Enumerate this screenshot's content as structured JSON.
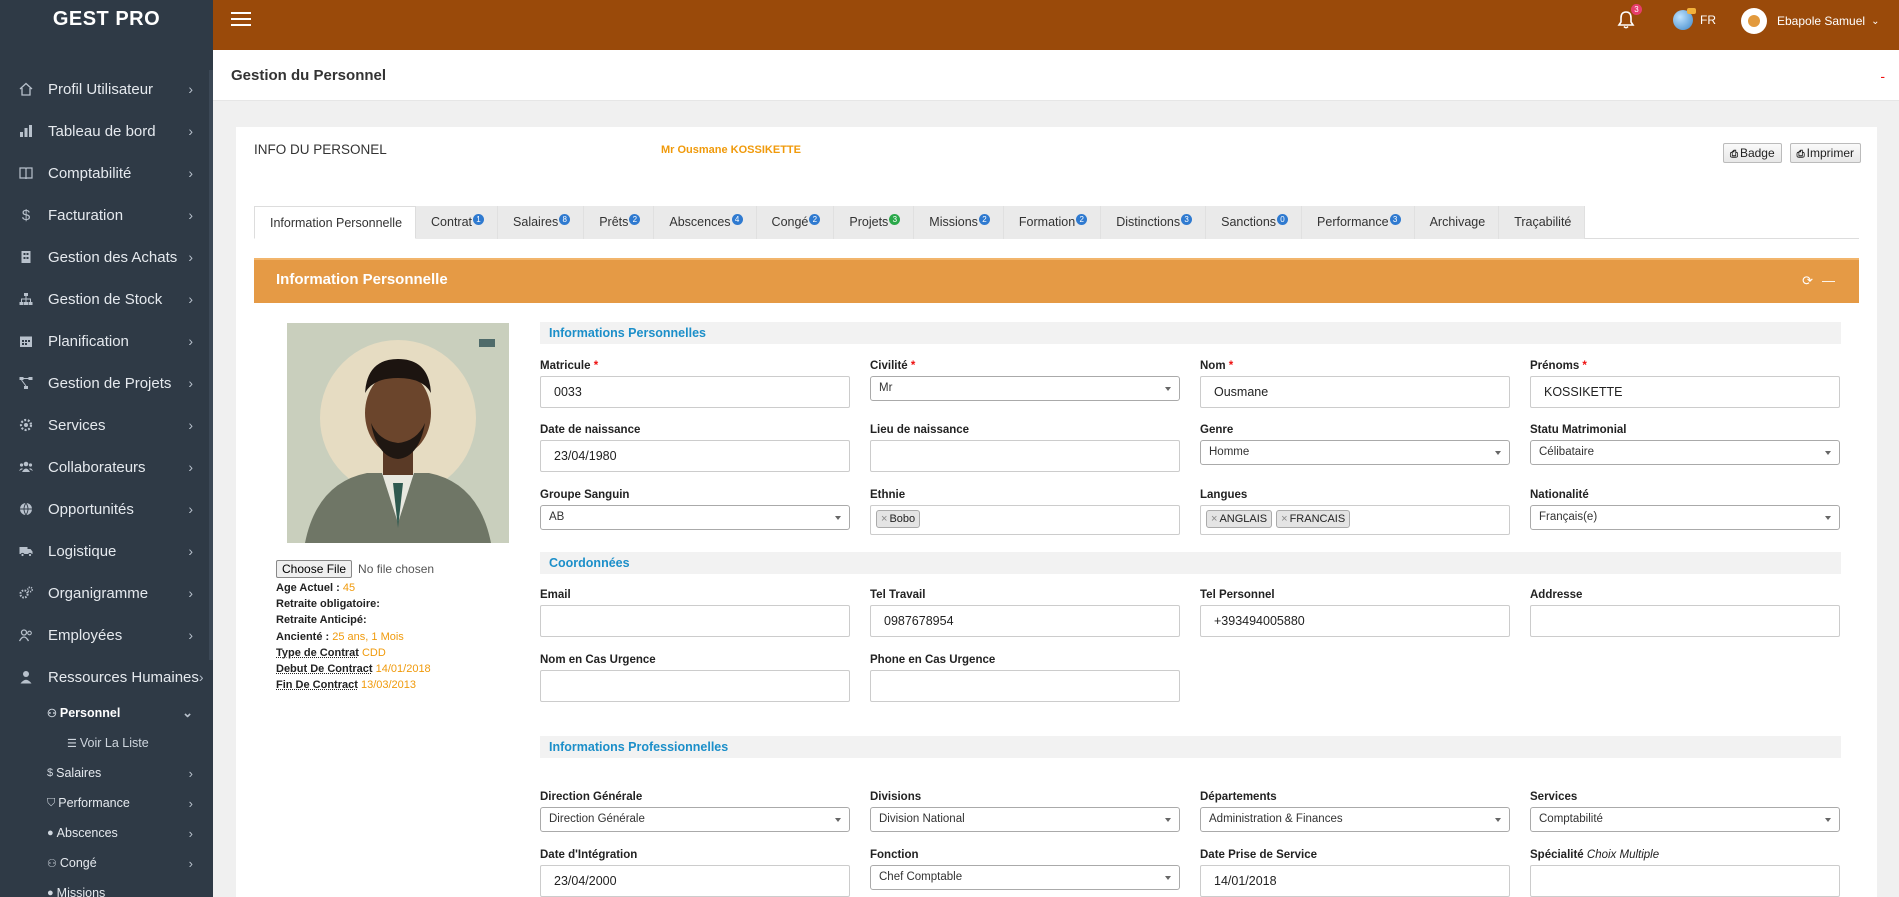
{
  "brand": "GEST PRO",
  "sidebar": {
    "items": [
      {
        "label": "Profil Utilisateur"
      },
      {
        "label": "Tableau de bord"
      },
      {
        "label": "Comptabilité"
      },
      {
        "label": "Facturation"
      },
      {
        "label": "Gestion des Achats"
      },
      {
        "label": "Gestion de Stock"
      },
      {
        "label": "Planification"
      },
      {
        "label": "Gestion de Projets"
      },
      {
        "label": "Services"
      },
      {
        "label": "Collaborateurs"
      },
      {
        "label": "Opportunités"
      },
      {
        "label": "Logistique"
      },
      {
        "label": "Organigramme"
      },
      {
        "label": "Employées"
      },
      {
        "label": "Ressources Humaines"
      }
    ],
    "sub": {
      "personnel": "Personnel",
      "voir_liste": "Voir La Liste",
      "salaires": "Salaires",
      "performance": "Performance",
      "abscences": "Abscences",
      "conge": "Congé",
      "missions": "Missions"
    }
  },
  "topbar": {
    "notif_count": "3",
    "lang": "FR",
    "user": "Ebapole Samuel"
  },
  "page": {
    "title": "Gestion du Personnel",
    "dash": "-"
  },
  "card": {
    "title": "INFO DU PERSONEL",
    "name": "Mr Ousmane KOSSIKETTE",
    "badge_btn": "Badge",
    "print_btn": "Imprimer"
  },
  "tabs": [
    {
      "label": "Information Personnelle",
      "count": ""
    },
    {
      "label": "Contrat",
      "count": "1"
    },
    {
      "label": "Salaires",
      "count": "8"
    },
    {
      "label": "Prêts",
      "count": "2"
    },
    {
      "label": "Abscences",
      "count": "4"
    },
    {
      "label": "Congé",
      "count": "2"
    },
    {
      "label": "Projets",
      "count": "3"
    },
    {
      "label": "Missions",
      "count": "2"
    },
    {
      "label": "Formation",
      "count": "2"
    },
    {
      "label": "Distinctions",
      "count": "3"
    },
    {
      "label": "Sanctions",
      "count": "0"
    },
    {
      "label": "Performance",
      "count": "3"
    },
    {
      "label": "Archivage",
      "count": ""
    },
    {
      "label": "Traçabilité",
      "count": ""
    }
  ],
  "panel": {
    "title": "Information Personnelle"
  },
  "left": {
    "file_btn": "Choose File",
    "file_txt": "No file chosen",
    "age_k": "Age Actuel :",
    "age_v": "45",
    "retraite_obl": "Retraite obligatoire:",
    "retraite_ant": "Retraite Anticipé:",
    "anciennete_k": "Ancienté :",
    "anciennete_v": "25 ans, 1 Mois",
    "contrat_k": "Type de Contrat",
    "contrat_v": "CDD",
    "debut_k": "Debut De Contract",
    "debut_v": "14/01/2018",
    "fin_k": "Fin De Contract",
    "fin_v": "13/03/2013"
  },
  "sections": {
    "perso": "Informations Personnelles",
    "coord": "Coordonnées",
    "pro": "Informations Professionnelles"
  },
  "form": {
    "matricule": {
      "label": "Matricule",
      "value": "0033"
    },
    "civilite": {
      "label": "Civilité",
      "value": "Mr"
    },
    "nom": {
      "label": "Nom",
      "value": "Ousmane"
    },
    "prenoms": {
      "label": "Prénoms",
      "value": "KOSSIKETTE"
    },
    "naissance": {
      "label": "Date de naissance",
      "value": "23/04/1980"
    },
    "lieu": {
      "label": "Lieu de naissance",
      "value": ""
    },
    "genre": {
      "label": "Genre",
      "value": "Homme"
    },
    "statu": {
      "label": "Statu Matrimonial",
      "value": "Célibataire"
    },
    "groupe": {
      "label": "Groupe Sanguin",
      "value": "AB"
    },
    "ethnie": {
      "label": "Ethnie",
      "tags": [
        "Bobo"
      ]
    },
    "langues": {
      "label": "Langues",
      "tags": [
        "ANGLAIS",
        "FRANCAIS"
      ]
    },
    "nationalite": {
      "label": "Nationalité",
      "value": "Français(e)"
    },
    "email": {
      "label": "Email",
      "value": ""
    },
    "tel_travail": {
      "label": "Tel Travail",
      "value": "0987678954"
    },
    "tel_perso": {
      "label": "Tel Personnel",
      "value": "+393494005880"
    },
    "adresse": {
      "label": "Addresse",
      "value": ""
    },
    "urgence_nom": {
      "label": "Nom en Cas Urgence",
      "value": ""
    },
    "urgence_tel": {
      "label": "Phone en Cas Urgence",
      "value": ""
    },
    "direction": {
      "label": "Direction Générale",
      "value": "Direction Générale"
    },
    "divisions": {
      "label": "Divisions",
      "value": "Division National"
    },
    "departements": {
      "label": "Départements",
      "value": "Administration & Finances"
    },
    "services": {
      "label": "Services",
      "value": "Comptabilité"
    },
    "integration": {
      "label": "Date d'Intégration",
      "value": "23/04/2000"
    },
    "fonction": {
      "label": "Fonction",
      "value": "Chef Comptable"
    },
    "prise_service": {
      "label": "Date Prise de Service",
      "value": "14/01/2018"
    },
    "specialite": {
      "label": "Spécialité",
      "hint": "Choix Multiple",
      "value": ""
    }
  },
  "colors": {
    "sidebar": "#2f3a46",
    "topbar": "#9a4a0a",
    "panel": "#e59a45",
    "accent_orange": "#f09a0b",
    "section_title": "#1c8fc9"
  }
}
